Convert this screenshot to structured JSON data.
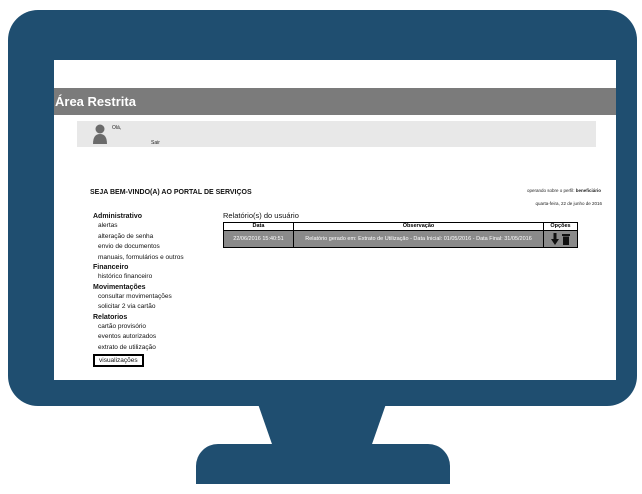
{
  "header": {
    "title": "Área Restrita"
  },
  "user": {
    "greeting": "Olá,",
    "logout": "Sair"
  },
  "welcome": "SEJA BEM-VINDO(A) AO PORTAL DE SERVIÇOS",
  "perfil": {
    "prefix": "operando sobre o perfil: ",
    "value": "beneficiário"
  },
  "date": "quarta-feira, 22 de junho de 2016",
  "sidebar": {
    "administrativo": {
      "title": "Administrativo",
      "items": [
        "alertas",
        "alteração de senha",
        "envio de documentos",
        "manuais, formulários e outros"
      ]
    },
    "financeiro": {
      "title": "Financeiro",
      "items": [
        "histórico financeiro"
      ]
    },
    "movimentacoes": {
      "title": "Movimentações",
      "items": [
        "consultar movimentações",
        "solicitar 2 via cartão"
      ]
    },
    "relatorios": {
      "title": "Relatorios",
      "items": [
        "cartão provisório",
        "eventos autorizados",
        "extrato de utilização",
        "visualizações"
      ]
    }
  },
  "reports": {
    "title": "Relatório(s) do usuário",
    "headers": [
      "Data",
      "Observação",
      "Opções"
    ],
    "rows": [
      {
        "date": "22/06/2016 15:40:51",
        "obs": "Relatório gerado em: Extrato de Utilização - Data Inicial: 01/05/2016 - Data Final: 31/05/2016"
      }
    ]
  },
  "icons": [
    "user-avatar-icon",
    "download-icon",
    "trash-icon"
  ]
}
